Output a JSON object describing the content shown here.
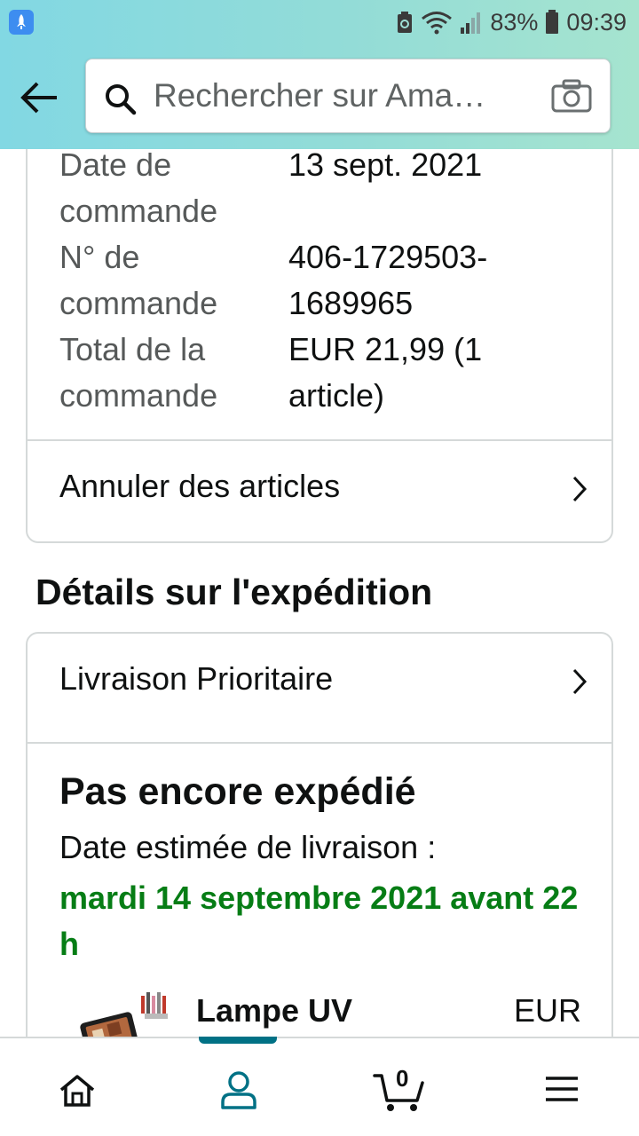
{
  "status_bar": {
    "battery_percent": "83%",
    "time": "09:39"
  },
  "search": {
    "placeholder": "Rechercher sur Ama…"
  },
  "order_summary": {
    "rows": [
      {
        "label": "Date de commande",
        "value": "13 sept. 2021"
      },
      {
        "label": "N° de commande",
        "value": "406-1729503-1689965"
      },
      {
        "label": "Total de la commande",
        "value": "EUR 21,99 (1 article)"
      }
    ],
    "cancel_link": "Annuler des articles"
  },
  "shipping": {
    "section_title": "Détails sur l'expédition",
    "delivery_option": "Livraison Prioritaire",
    "status": "Pas encore expédié",
    "estimated_label": "Date estimée de livraison :",
    "estimated_date": "mardi 14 septembre 2021 avant 22 h",
    "product": {
      "name": "Lampe UV",
      "price": "EUR"
    }
  },
  "bottom_nav": {
    "cart_count": "0",
    "active": "account"
  },
  "colors": {
    "accent": "#007185",
    "delivery_green": "#067d15",
    "header_gradient_start": "#82d8e3",
    "header_gradient_end": "#a6e4cf"
  }
}
